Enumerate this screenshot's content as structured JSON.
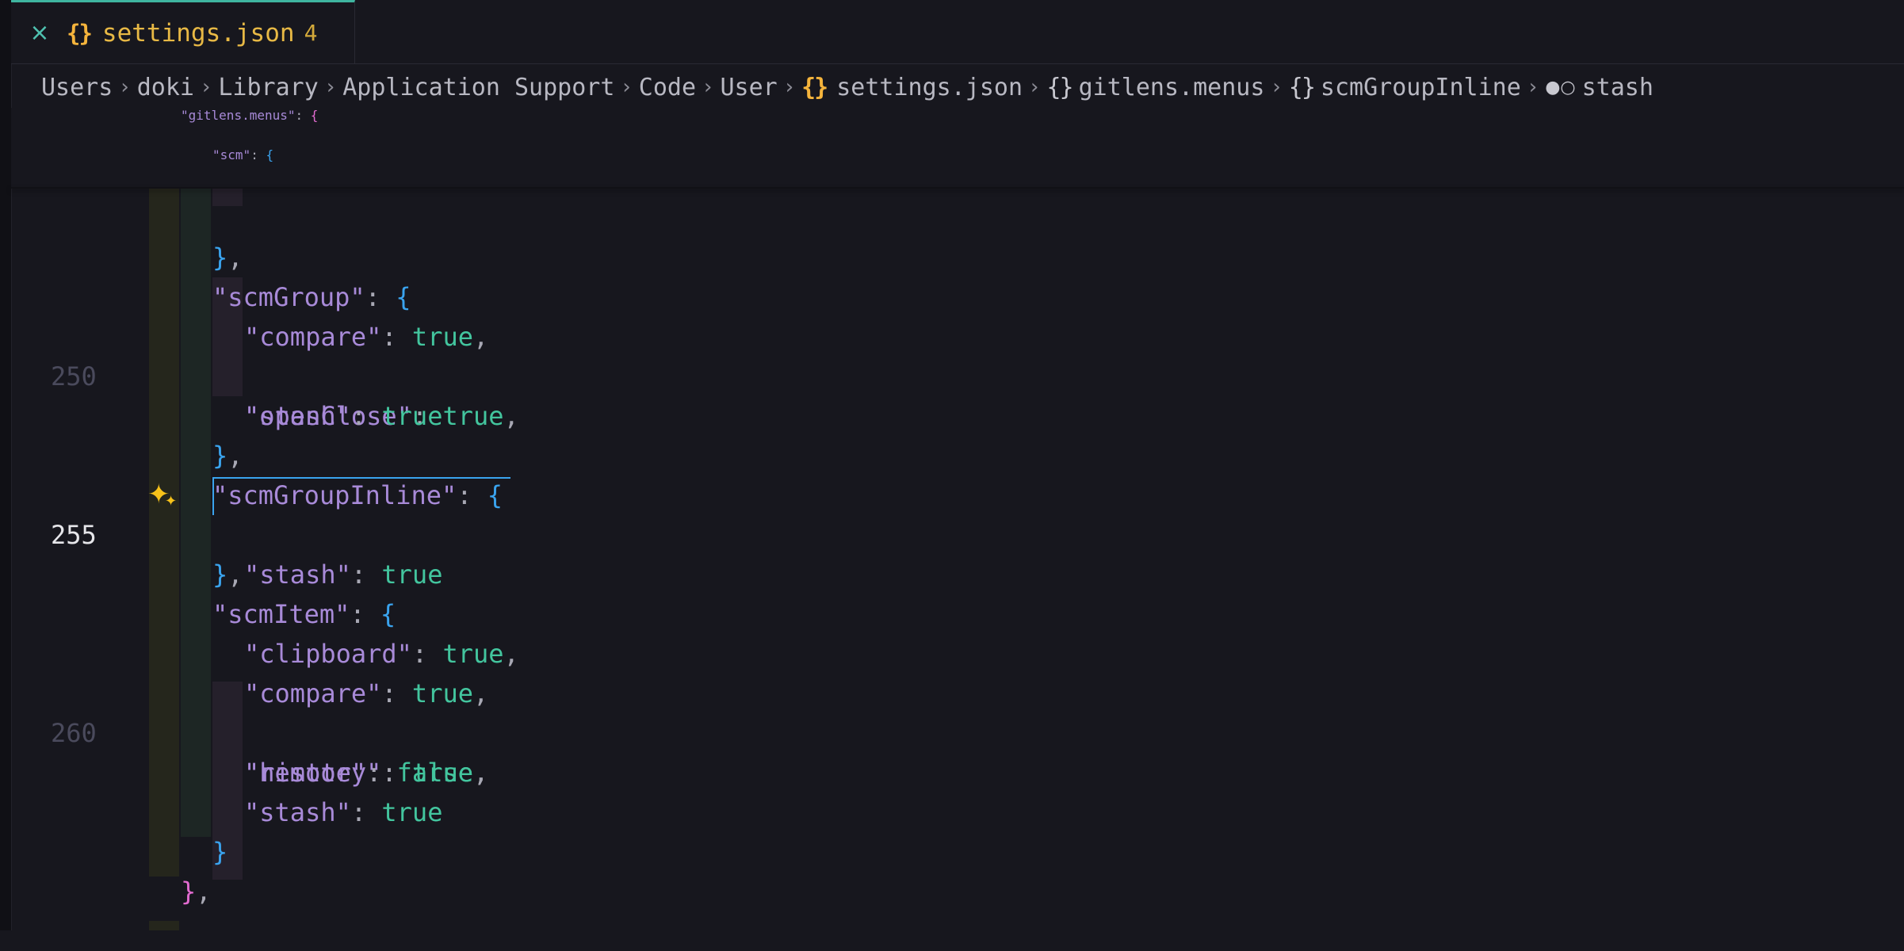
{
  "tab": {
    "close_glyph": "×",
    "icon_glyph": "{}",
    "filename": "settings.json",
    "problem_count": "4"
  },
  "breadcrumb": {
    "items": [
      "Users",
      "doki",
      "Library",
      "Application Support",
      "Code",
      "User"
    ],
    "file": "settings.json",
    "object1": "gitlens.menus",
    "object2": "scmGroupInline",
    "property": "stash",
    "separator": ">"
  },
  "sticky": {
    "line1": {
      "key": "gitlens.menus",
      "open": "{"
    },
    "line2": {
      "key": "scm",
      "open": "{"
    }
  },
  "editor": {
    "line_numbers": {
      "l250": "250",
      "l255": "255",
      "l260": "260"
    },
    "lines": [
      {
        "key": "scmGroup",
        "open": "{"
      },
      {
        "key": "compare",
        "value": "true"
      },
      {
        "key": "openClose",
        "value": "true"
      },
      {
        "key": "stash",
        "value": "true"
      },
      {
        "key": "scmGroupInline",
        "open": "{"
      },
      {
        "key": "stash",
        "value": "true"
      },
      {
        "key": "scmItem",
        "open": "{"
      },
      {
        "key": "clipboard",
        "value": "true"
      },
      {
        "key": "compare",
        "value": "true"
      },
      {
        "key": "history",
        "value": "true"
      },
      {
        "key": "remote",
        "value": "false"
      },
      {
        "key": "stash",
        "value": "true"
      }
    ]
  },
  "colors": {
    "accent": "#3fb5a0",
    "tab_label": "#e8b945",
    "key": "#a88ad8",
    "boolean": "#43c59e",
    "brace_level1": "#e26bd0",
    "brace_level2": "#3aa3ee",
    "sparkle": "#f7c21a"
  },
  "icons": {
    "tab_close": "close-icon",
    "json_file": "json-braces-icon",
    "object": "object-braces-icon",
    "boolean": "boolean-icon",
    "chevron": "chevron-right-icon",
    "ai": "sparkle-icon"
  }
}
